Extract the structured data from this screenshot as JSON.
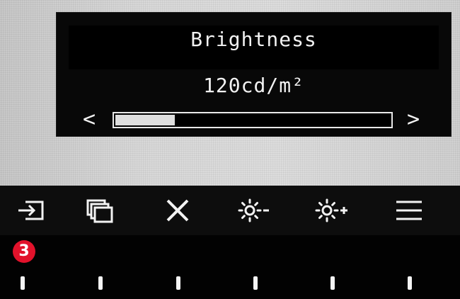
{
  "osd": {
    "title": "Brightness",
    "value": "120cd/m²",
    "left_arrow": "<",
    "right_arrow": ">",
    "slider_level_percent": 22
  },
  "buttons": [
    {
      "icon": "input-select-icon"
    },
    {
      "icon": "color-mode-icon"
    },
    {
      "icon": "close-icon"
    },
    {
      "icon": "brightness-down-icon"
    },
    {
      "icon": "brightness-up-icon"
    },
    {
      "icon": "menu-icon"
    }
  ],
  "badge": {
    "label": "3",
    "color": "#e2122b"
  }
}
